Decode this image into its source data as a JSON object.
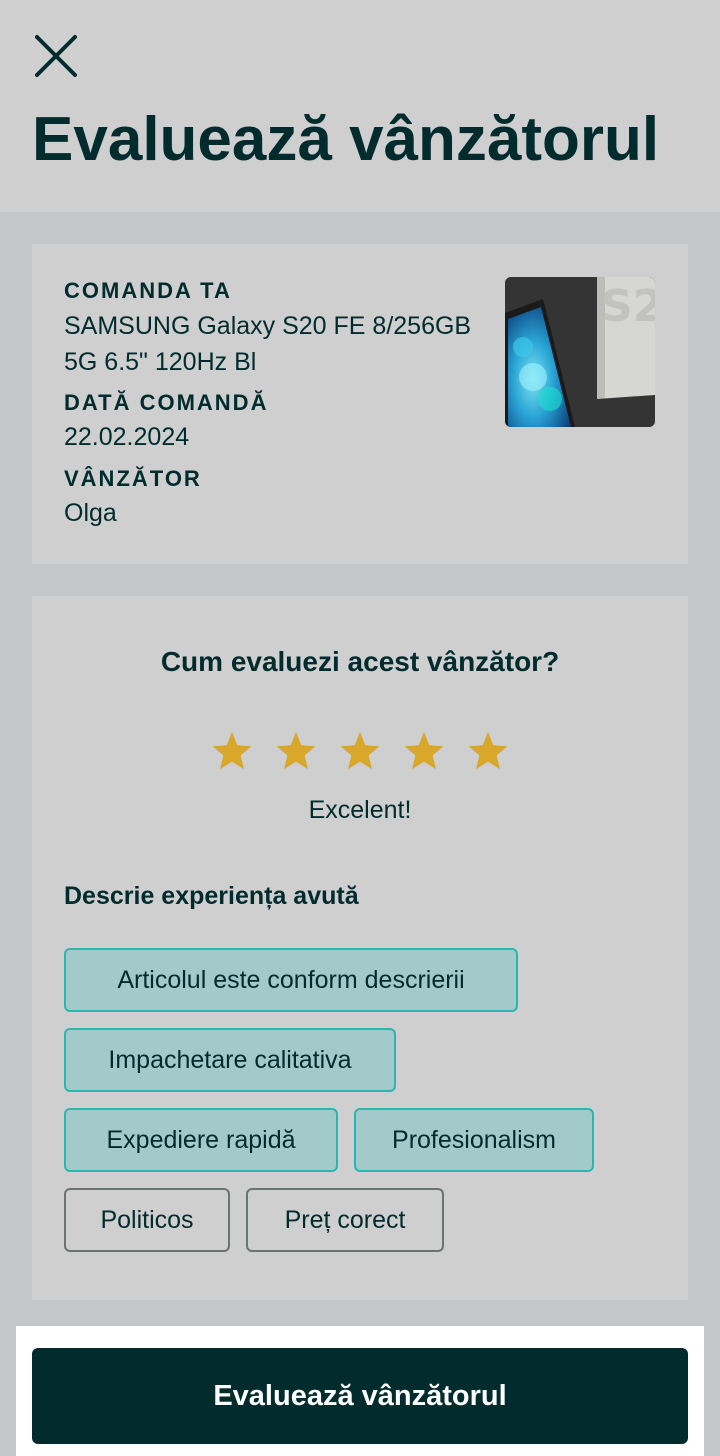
{
  "header": {
    "title": "Evaluează vânzătorul",
    "close_icon": "close-icon"
  },
  "order": {
    "order_label": "COMANDA TA",
    "product_line1": "SAMSUNG Galaxy S20 FE 8/256GB",
    "product_line2": "5G 6.5\" 120Hz Bl",
    "date_label": "DATĂ COMANDĂ",
    "date_value": "22.02.2024",
    "seller_label": "VÂNZĂTOR",
    "seller_value": "Olga"
  },
  "rating": {
    "question": "Cum evaluezi acest vânzător?",
    "stars_selected": 5,
    "stars_total": 5,
    "star_color": "#d9a82b",
    "label": "Excelent!"
  },
  "experience": {
    "title": "Descrie experiența avută",
    "chips": [
      {
        "label": "Articolul este conform descrierii",
        "selected": true
      },
      {
        "label": "Impachetare calitativa",
        "selected": true
      },
      {
        "label": "Expediere rapidă",
        "selected": true
      },
      {
        "label": "Profesionalism",
        "selected": true
      },
      {
        "label": "Politicos",
        "selected": false
      },
      {
        "label": "Preț corect",
        "selected": false
      }
    ]
  },
  "footer": {
    "submit_label": "Evaluează vânzătorul"
  },
  "colors": {
    "primary": "#022b2e",
    "chip_selected_bg": "#a3cacb",
    "chip_selected_border": "#2bb6b0"
  }
}
